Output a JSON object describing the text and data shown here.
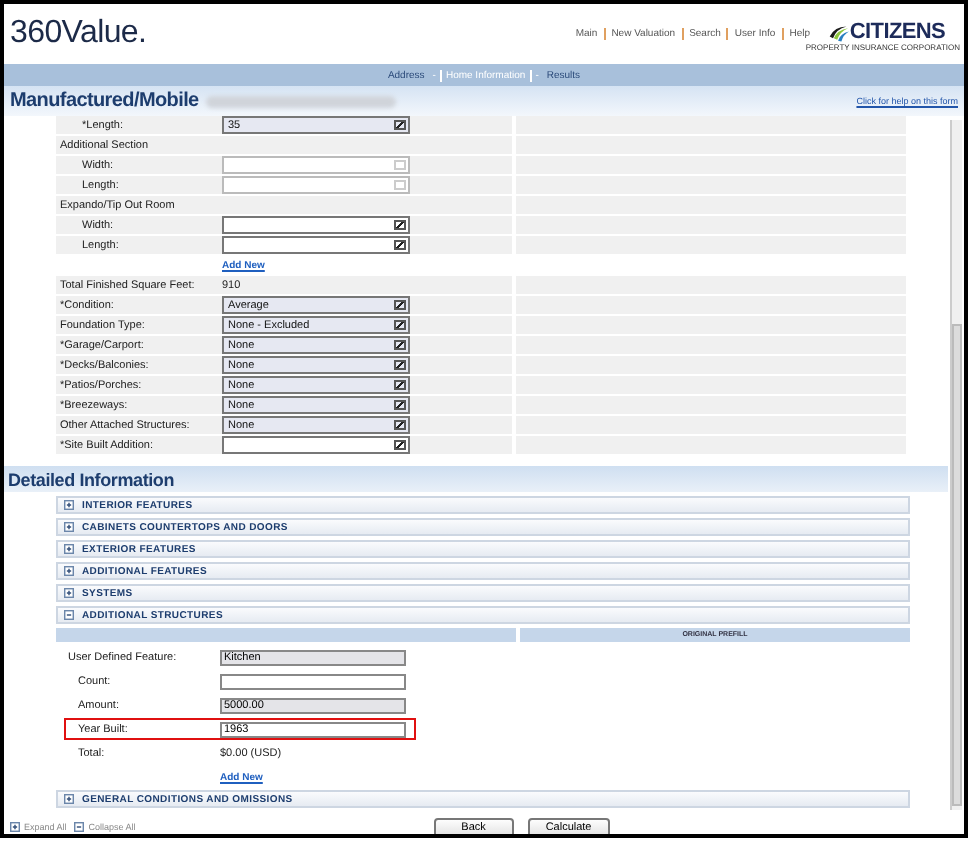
{
  "header": {
    "logo": "360Value.",
    "links": [
      "Main",
      "New Valuation",
      "Search",
      "User Info",
      "Help"
    ],
    "brand": {
      "name": "CITIZENS",
      "tagline": "PROPERTY INSURANCE CORPORATION"
    }
  },
  "breadcrumb": [
    {
      "kind": "step",
      "label": "Address",
      "selected": false
    },
    {
      "kind": "sep",
      "label": "-"
    },
    {
      "kind": "step",
      "label": "Home Information",
      "selected": true
    },
    {
      "kind": "sep",
      "label": "-"
    },
    {
      "kind": "step",
      "label": "Results",
      "selected": false
    }
  ],
  "title": "Manufactured/Mobile",
  "help_link": "Click for help on this form",
  "form_rows": [
    {
      "kind": "group",
      "children": [
        {
          "kind": "select",
          "label": "*Length:",
          "value": "35",
          "disabled": false
        }
      ]
    },
    {
      "kind": "group",
      "label": "Additional Section",
      "children": [
        {
          "kind": "select",
          "label": "Width:",
          "disabled": true
        },
        {
          "kind": "select",
          "label": "Length:",
          "disabled": true
        }
      ]
    },
    {
      "kind": "group",
      "label": "Expando/Tip Out Room",
      "children": [
        {
          "kind": "select",
          "label": "Width:",
          "disabled": false
        },
        {
          "kind": "select",
          "label": "Length:",
          "disabled": false
        },
        {
          "kind": "link",
          "label": "Add New"
        }
      ]
    },
    {
      "kind": "value",
      "label": "Total Finished Square Feet:",
      "value": "910"
    },
    {
      "kind": "select",
      "label": "*Condition:",
      "value": "Average",
      "disabled": false
    },
    {
      "kind": "select",
      "label": "Foundation Type:",
      "value": "None - Excluded",
      "disabled": false
    },
    {
      "kind": "select",
      "label": "*Garage/Carport:",
      "value": "None",
      "disabled": false
    },
    {
      "kind": "select",
      "label": "*Decks/Balconies:",
      "value": "None",
      "disabled": false
    },
    {
      "kind": "select",
      "label": "*Patios/Porches:",
      "value": "None",
      "disabled": false
    },
    {
      "kind": "select",
      "label": "*Breezeways:",
      "value": "None",
      "disabled": false
    },
    {
      "kind": "select",
      "label": " Other Attached Structures:",
      "value": "None",
      "disabled": false
    },
    {
      "kind": "select",
      "label": "*Site Built Addition:",
      "disabled": false
    }
  ],
  "detail_heading": "Detailed Information",
  "sections": [
    {
      "label": "INTERIOR FEATURES",
      "expanded": false
    },
    {
      "label": "CABINETS COUNTERTOPS AND DOORS",
      "expanded": false
    },
    {
      "label": "EXTERIOR FEATURES",
      "expanded": false
    },
    {
      "label": "ADDITIONAL FEATURES",
      "expanded": false
    },
    {
      "label": "SYSTEMS",
      "expanded": false
    },
    {
      "label": "ADDITIONAL STRUCTURES",
      "expanded": true,
      "column_header": "ORIGINAL PREFILL",
      "fields": [
        {
          "kind": "input",
          "label": "User Defined Feature:",
          "value": "Kitchen",
          "readonly": true,
          "children": [
            {
              "kind": "input",
              "label": "Count:",
              "readonly": false
            },
            {
              "kind": "input",
              "label": "Amount:",
              "value": "5000.00",
              "readonly": true
            },
            {
              "kind": "input",
              "label": "Year Built:",
              "value": "1963",
              "readonly": false,
              "highlighted": true
            },
            {
              "kind": "value",
              "label": "Total:",
              "value": "$0.00 (USD)"
            }
          ]
        },
        {
          "kind": "link",
          "label": "Add New"
        }
      ]
    },
    {
      "label": "GENERAL CONDITIONS AND OMISSIONS",
      "expanded": false
    }
  ],
  "footer": {
    "expand_all": "Expand All",
    "collapse_all": "Collapse All",
    "buttons": [
      "Back",
      "Calculate"
    ]
  }
}
